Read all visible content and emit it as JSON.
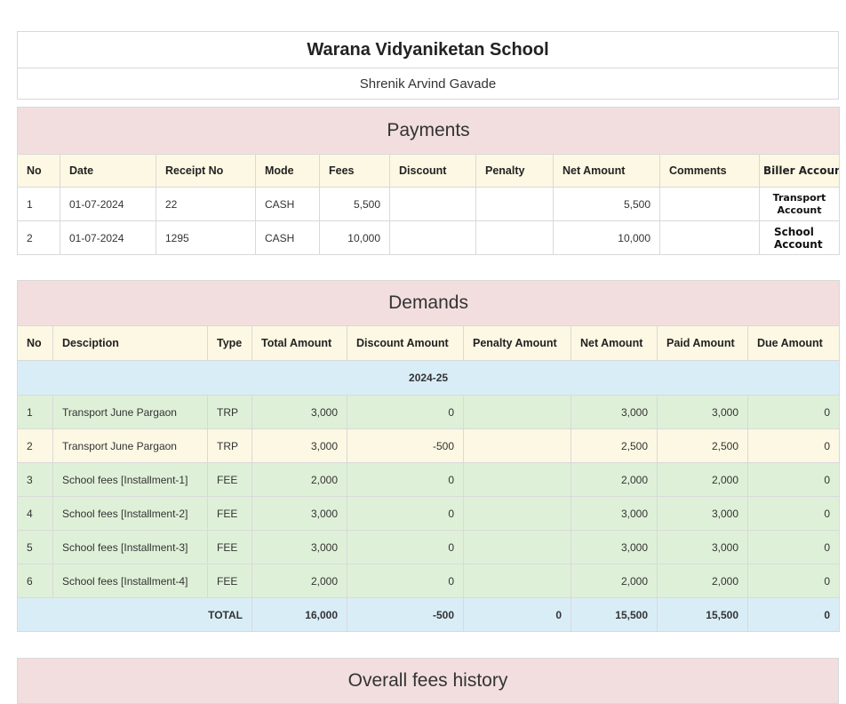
{
  "header": {
    "school_name": "Warana Vidyaniketan School",
    "student_name": "Shrenik Arvind Gavade"
  },
  "payments": {
    "title": "Payments",
    "columns": [
      "No",
      "Date",
      "Receipt No",
      "Mode",
      "Fees",
      "Discount",
      "Penalty",
      "Net Amount",
      "Comments",
      "Biller Account"
    ],
    "rows": [
      {
        "no": "1",
        "date": "01-07-2024",
        "receipt": "22",
        "mode": "CASH",
        "fees": "5,500",
        "discount": "",
        "penalty": "",
        "net": "5,500",
        "comments": "",
        "biller": "Transport Account"
      },
      {
        "no": "2",
        "date": "01-07-2024",
        "receipt": "1295",
        "mode": "CASH",
        "fees": "10,000",
        "discount": "",
        "penalty": "",
        "net": "10,000",
        "comments": "",
        "biller": "School Account"
      }
    ]
  },
  "demands": {
    "title": "Demands",
    "columns": [
      "No",
      "Desciption",
      "Type",
      "Total Amount",
      "Discount Amount",
      "Penalty Amount",
      "Net Amount",
      "Paid Amount",
      "Due Amount"
    ],
    "year": "2024-25",
    "rows": [
      {
        "no": "1",
        "desc": "Transport June Pargaon",
        "type": "TRP",
        "total": "3,000",
        "discount": "0",
        "penalty": "",
        "net": "3,000",
        "paid": "3,000",
        "due": "0",
        "status": "success"
      },
      {
        "no": "2",
        "desc": "Transport June Pargaon",
        "type": "TRP",
        "total": "3,000",
        "discount": "-500",
        "penalty": "",
        "net": "2,500",
        "paid": "2,500",
        "due": "0",
        "status": "warning"
      },
      {
        "no": "3",
        "desc": "School fees [Installment-1]",
        "type": "FEE",
        "total": "2,000",
        "discount": "0",
        "penalty": "",
        "net": "2,000",
        "paid": "2,000",
        "due": "0",
        "status": "success"
      },
      {
        "no": "4",
        "desc": "School fees [Installment-2]",
        "type": "FEE",
        "total": "3,000",
        "discount": "0",
        "penalty": "",
        "net": "3,000",
        "paid": "3,000",
        "due": "0",
        "status": "success"
      },
      {
        "no": "5",
        "desc": "School fees [Installment-3]",
        "type": "FEE",
        "total": "3,000",
        "discount": "0",
        "penalty": "",
        "net": "3,000",
        "paid": "3,000",
        "due": "0",
        "status": "success"
      },
      {
        "no": "6",
        "desc": "School fees [Installment-4]",
        "type": "FEE",
        "total": "2,000",
        "discount": "0",
        "penalty": "",
        "net": "2,000",
        "paid": "2,000",
        "due": "0",
        "status": "success"
      }
    ],
    "total": {
      "label": "TOTAL",
      "total": "16,000",
      "discount": "-500",
      "penalty": "0",
      "net": "15,500",
      "paid": "15,500",
      "due": "0"
    }
  },
  "history": {
    "title": "Overall fees history"
  },
  "colors": {
    "section_title_bg": "#f2dede",
    "header_bg": "#fcf8e3",
    "info_bg": "#d9edf7",
    "success_bg": "#dff0d8",
    "warning_bg": "#fcf8e3"
  }
}
